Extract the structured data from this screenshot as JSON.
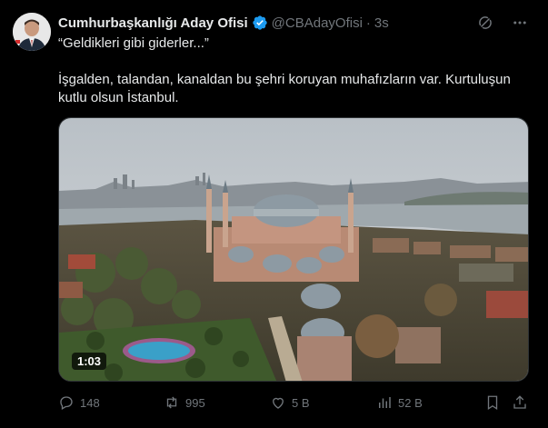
{
  "tweet": {
    "author_name": "Cumhurbaşkanlığı Aday Ofisi",
    "author_handle": "@CBAdayOfisi",
    "separator": "·",
    "time": "3s",
    "quote_line": "“Geldikleri gibi giderler...”",
    "body_line_1": "İşgalden, talandan, kanaldan bu şehri koruyan muhafızların var. Kurtuluşun",
    "body_line_2": "kutlu olsun İstanbul.",
    "video_duration": "1:03"
  },
  "stats": {
    "replies": "148",
    "reposts": "995",
    "likes": "5 B",
    "views": "52 B"
  },
  "colors": {
    "background": "#000000",
    "text_primary": "#e7e9ea",
    "text_secondary": "#71767b",
    "verified": "#1d9bf0"
  },
  "icons": [
    "verified-badge-icon",
    "grok-icon",
    "more-icon",
    "reply-icon",
    "repost-icon",
    "like-icon",
    "views-icon",
    "bookmark-icon",
    "share-icon"
  ]
}
